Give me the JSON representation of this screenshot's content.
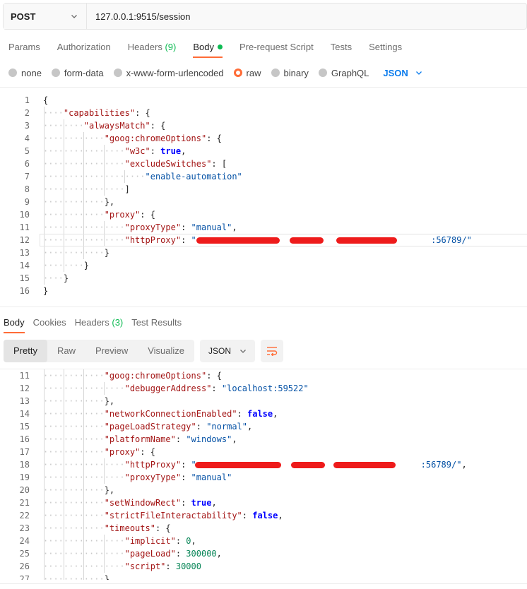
{
  "request": {
    "method": "POST",
    "url": "127.0.0.1:9515/session"
  },
  "request_tabs": {
    "params": "Params",
    "authorization": "Authorization",
    "headers": "Headers",
    "headers_count": "(9)",
    "body": "Body",
    "pre_request": "Pre-request Script",
    "tests": "Tests",
    "settings": "Settings"
  },
  "body_types": {
    "none": "none",
    "form_data": "form-data",
    "urlencoded": "x-www-form-urlencoded",
    "raw": "raw",
    "binary": "binary",
    "graphql": "GraphQL",
    "selected": "raw",
    "language": "JSON"
  },
  "request_body_lines": [
    {
      "n": "1",
      "t": [
        [
          "{",
          "p"
        ]
      ]
    },
    {
      "n": "2",
      "t": [
        [
          "\"capabilities\"",
          "k"
        ],
        [
          ": {",
          "p"
        ]
      ]
    },
    {
      "n": "3",
      "t": [
        [
          "\"alwaysMatch\"",
          "k"
        ],
        [
          ": {",
          "p"
        ]
      ]
    },
    {
      "n": "4",
      "t": [
        [
          "\"goog:chromeOptions\"",
          "k"
        ],
        [
          ": {",
          "p"
        ]
      ]
    },
    {
      "n": "5",
      "t": [
        [
          "\"w3c\"",
          "k"
        ],
        [
          ": ",
          "p"
        ],
        [
          "true",
          "b"
        ],
        [
          ",",
          "p"
        ]
      ]
    },
    {
      "n": "6",
      "t": [
        [
          "\"excludeSwitches\"",
          "k"
        ],
        [
          ": [",
          "p"
        ]
      ]
    },
    {
      "n": "7",
      "t": [
        [
          "\"enable-automation\"",
          "s"
        ]
      ]
    },
    {
      "n": "8",
      "t": [
        [
          "]",
          "p"
        ]
      ]
    },
    {
      "n": "9",
      "t": [
        [
          "},",
          "p"
        ]
      ]
    },
    {
      "n": "10",
      "t": [
        [
          "\"proxy\"",
          "k"
        ],
        [
          ": {",
          "p"
        ]
      ]
    },
    {
      "n": "11",
      "t": [
        [
          "\"proxyType\"",
          "k"
        ],
        [
          ": ",
          "p"
        ],
        [
          "\"manual\"",
          "s"
        ],
        [
          ",",
          "p"
        ]
      ]
    },
    {
      "n": "12",
      "t": [
        [
          "\"httpProxy\"",
          "k"
        ],
        [
          ": ",
          "p"
        ],
        [
          "\"",
          "s"
        ],
        [
          "                                              ",
          "p"
        ],
        [
          ":56789/\"",
          "s"
        ]
      ]
    },
    {
      "n": "13",
      "t": [
        [
          "}",
          "p"
        ]
      ]
    },
    {
      "n": "14",
      "t": [
        [
          "}",
          "p"
        ]
      ]
    },
    {
      "n": "15",
      "t": [
        [
          "}",
          "p"
        ]
      ]
    },
    {
      "n": "16",
      "t": [
        [
          "}",
          "p"
        ]
      ]
    }
  ],
  "response_tabs": {
    "body": "Body",
    "cookies": "Cookies",
    "headers": "Headers",
    "headers_count": "(3)",
    "test_results": "Test Results"
  },
  "response_toolbar": {
    "pretty": "Pretty",
    "raw": "Raw",
    "preview": "Preview",
    "visualize": "Visualize",
    "format": "JSON"
  },
  "response_body_lines": [
    {
      "n": "11",
      "t": [
        [
          "\"goog:chromeOptions\"",
          "k"
        ],
        [
          ": {",
          "p"
        ]
      ]
    },
    {
      "n": "12",
      "t": [
        [
          "\"debuggerAddress\"",
          "k"
        ],
        [
          ": ",
          "p"
        ],
        [
          "\"localhost:59522\"",
          "s"
        ]
      ]
    },
    {
      "n": "13",
      "t": [
        [
          "},",
          "p"
        ]
      ]
    },
    {
      "n": "14",
      "t": [
        [
          "\"networkConnectionEnabled\"",
          "k"
        ],
        [
          ": ",
          "p"
        ],
        [
          "false",
          "b"
        ],
        [
          ",",
          "p"
        ]
      ]
    },
    {
      "n": "15",
      "t": [
        [
          "\"pageLoadStrategy\"",
          "k"
        ],
        [
          ": ",
          "p"
        ],
        [
          "\"normal\"",
          "s"
        ],
        [
          ",",
          "p"
        ]
      ]
    },
    {
      "n": "16",
      "t": [
        [
          "\"platformName\"",
          "k"
        ],
        [
          ": ",
          "p"
        ],
        [
          "\"windows\"",
          "s"
        ],
        [
          ",",
          "p"
        ]
      ]
    },
    {
      "n": "17",
      "t": [
        [
          "\"proxy\"",
          "k"
        ],
        [
          ": {",
          "p"
        ]
      ]
    },
    {
      "n": "18",
      "t": [
        [
          "\"httpProxy\"",
          "k"
        ],
        [
          ": ",
          "p"
        ],
        [
          "\"",
          "s"
        ],
        [
          "                                            ",
          "p"
        ],
        [
          ":56789/\"",
          "s"
        ],
        [
          ",",
          "p"
        ]
      ]
    },
    {
      "n": "19",
      "t": [
        [
          "\"proxyType\"",
          "k"
        ],
        [
          ": ",
          "p"
        ],
        [
          "\"manual\"",
          "s"
        ]
      ]
    },
    {
      "n": "20",
      "t": [
        [
          "},",
          "p"
        ]
      ]
    },
    {
      "n": "21",
      "t": [
        [
          "\"setWindowRect\"",
          "k"
        ],
        [
          ": ",
          "p"
        ],
        [
          "true",
          "b"
        ],
        [
          ",",
          "p"
        ]
      ]
    },
    {
      "n": "22",
      "t": [
        [
          "\"strictFileInteractability\"",
          "k"
        ],
        [
          ": ",
          "p"
        ],
        [
          "false",
          "b"
        ],
        [
          ",",
          "p"
        ]
      ]
    },
    {
      "n": "23",
      "t": [
        [
          "\"timeouts\"",
          "k"
        ],
        [
          ": {",
          "p"
        ]
      ]
    },
    {
      "n": "24",
      "t": [
        [
          "\"implicit\"",
          "k"
        ],
        [
          ": ",
          "p"
        ],
        [
          "0",
          "n"
        ],
        [
          ",",
          "p"
        ]
      ]
    },
    {
      "n": "25",
      "t": [
        [
          "\"pageLoad\"",
          "k"
        ],
        [
          ": ",
          "p"
        ],
        [
          "300000",
          "n"
        ],
        [
          ",",
          "p"
        ]
      ]
    },
    {
      "n": "26",
      "t": [
        [
          "\"script\"",
          "k"
        ],
        [
          ": ",
          "p"
        ],
        [
          "30000",
          "n"
        ]
      ]
    },
    {
      "n": "27",
      "t": [
        [
          "},",
          "p"
        ]
      ]
    }
  ],
  "colors": {
    "accent": "#ff6c37",
    "success": "#0cbb52",
    "link": "#097bed",
    "key": "#a31515",
    "string": "#0451a5",
    "redaction": "#ee1b1b"
  }
}
